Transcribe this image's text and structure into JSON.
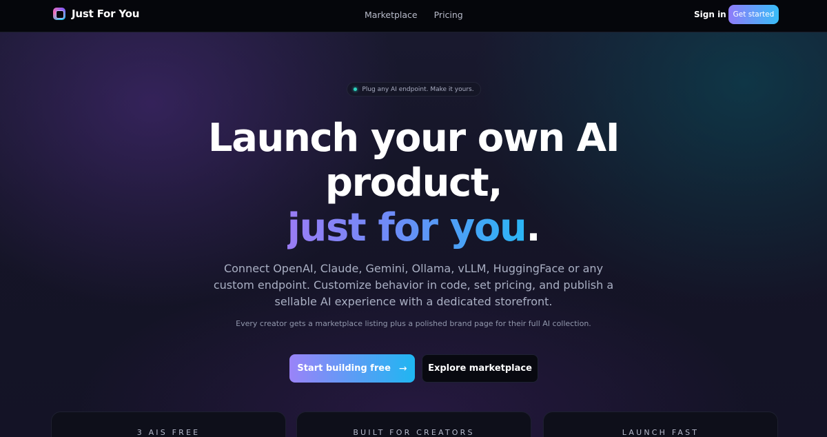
{
  "brand": {
    "name": "Just For You",
    "logo_icon": "cube-logo-icon"
  },
  "nav": {
    "links": [
      {
        "label": "Marketplace"
      },
      {
        "label": "Pricing"
      }
    ],
    "signin_label": "Sign in",
    "cta_label": "Get started"
  },
  "hero": {
    "pill_text": "Plug any AI endpoint. Make it yours.",
    "headline_line1": "Launch your own AI",
    "headline_line2": "product,",
    "headline_gradient": "just for you",
    "headline_period": ".",
    "description": "Connect OpenAI, Claude, Gemini, Ollama, vLLM, HuggingFace or any custom endpoint. Customize behavior in code, set pricing, and publish a sellable AI experience with a dedicated storefront.",
    "subnote": "Every creator gets a marketplace listing plus a polished brand page for their full AI collection.",
    "primary_button": "Start building free",
    "primary_button_icon": "→",
    "secondary_button": "Explore marketplace"
  },
  "cards": [
    {
      "label": "3 AIs FREE"
    },
    {
      "label": "BUILT FOR CREATORS"
    },
    {
      "label": "LAUNCH FAST"
    }
  ],
  "colors": {
    "accent_start": "#9a83f8",
    "accent_end": "#1fb6f2",
    "nav_bg": "#05060b",
    "pill_dot": "#2dd4bf"
  }
}
